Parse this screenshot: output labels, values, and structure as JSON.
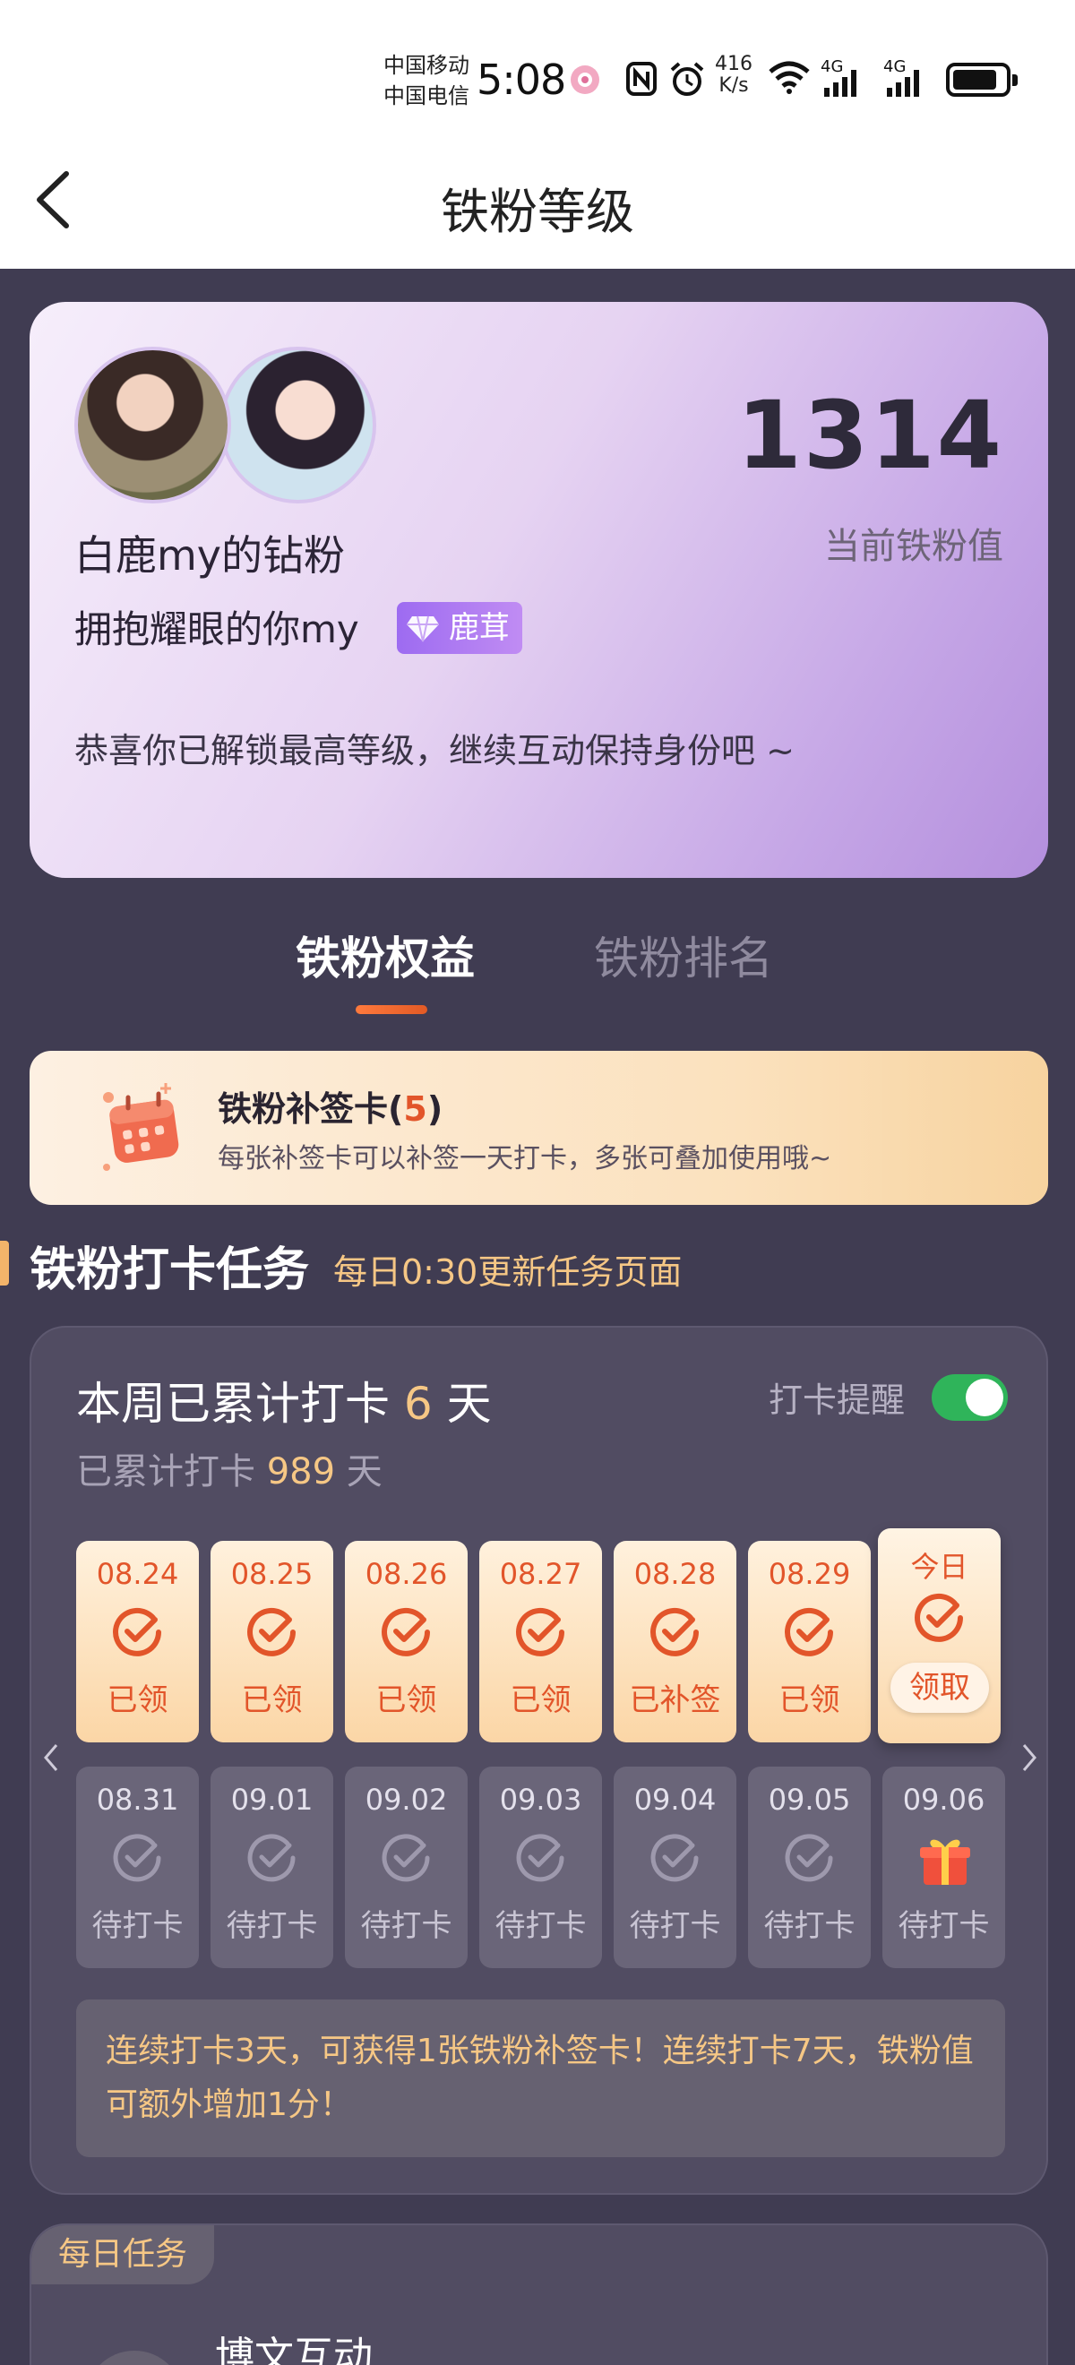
{
  "status_bar": {
    "carrier_1": "中国移动",
    "carrier_2": "中国电信",
    "time": "5:08",
    "speed_value": "416",
    "speed_unit": "K/s",
    "network_1": "4G",
    "network_2": "4G"
  },
  "header": {
    "title": "铁粉等级"
  },
  "profile": {
    "fan_name": "白鹿my的钻粉",
    "nickname": "拥抱耀眼的你my",
    "badge_label": "鹿茸",
    "fan_value": "1314",
    "fan_value_label": "当前铁粉值",
    "congrats": "恭喜你已解锁最高等级，继续互动保持身份吧 ~"
  },
  "tabs": [
    {
      "label": "铁粉权益",
      "active": true
    },
    {
      "label": "铁粉排名",
      "active": false
    }
  ],
  "makeup_card": {
    "title": "铁粉补签卡(",
    "count": "5",
    "title_end": ")",
    "desc": "每张补签卡可以补签一天打卡，多张可叠加使用哦~"
  },
  "checkin_section": {
    "title": "铁粉打卡任务",
    "subtitle": "每日0:30更新任务页面",
    "week_prefix": "本周已累计打卡",
    "week_count": "6",
    "week_suffix": "天",
    "total_prefix": "已累计打卡",
    "total_count": "989",
    "total_suffix": "天",
    "remind_label": "打卡提醒",
    "remind_on": true,
    "week_days": [
      {
        "date": "08.24",
        "status": "已领"
      },
      {
        "date": "08.25",
        "status": "已领"
      },
      {
        "date": "08.26",
        "status": "已领"
      },
      {
        "date": "08.27",
        "status": "已领"
      },
      {
        "date": "08.28",
        "status": "已补签"
      },
      {
        "date": "08.29",
        "status": "已领"
      },
      {
        "date": "今日",
        "status": "领取"
      }
    ],
    "next_days": [
      {
        "date": "08.31",
        "status": "待打卡"
      },
      {
        "date": "09.01",
        "status": "待打卡"
      },
      {
        "date": "09.02",
        "status": "待打卡"
      },
      {
        "date": "09.03",
        "status": "待打卡"
      },
      {
        "date": "09.04",
        "status": "待打卡"
      },
      {
        "date": "09.05",
        "status": "待打卡"
      },
      {
        "date": "09.06",
        "status": "待打卡"
      }
    ],
    "tip": "连续打卡3天，可获得1张铁粉补签卡！连续打卡7天，铁粉值可额外增加1分！"
  },
  "daily_tasks": {
    "label": "每日任务",
    "first_task_title": "博文互动"
  },
  "colors": {
    "background": "#403c52",
    "accent_orange": "#e2552a",
    "accent_gold": "#f6c785",
    "toggle_on": "#2fb45a",
    "badge_purple": "#9d6bf1"
  },
  "icons": {
    "back": "chevron-left-icon",
    "check": "check-circle-icon",
    "gift": "gift-icon",
    "calendar": "calendar-icon",
    "gem": "diamond-icon"
  }
}
